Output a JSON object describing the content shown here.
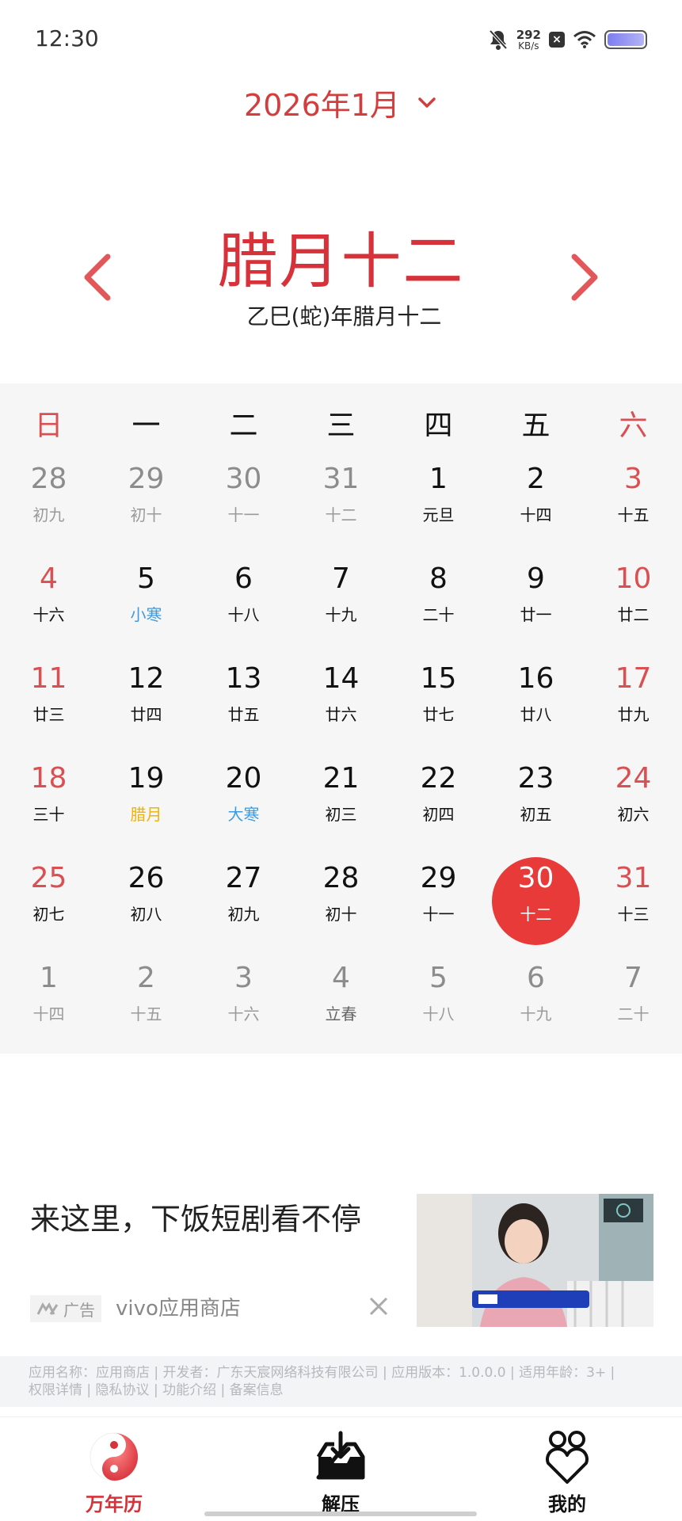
{
  "status_bar": {
    "time": "12:30",
    "net_speed_value": "292",
    "net_speed_unit": "KB/s",
    "icons": [
      "bell-muted-icon",
      "close-box-icon",
      "wifi-icon",
      "battery-icon"
    ]
  },
  "header": {
    "month_title": "2026年1月",
    "lunar_date": "腊月十二",
    "lunar_full": "乙巳(蛇)年腊月十二",
    "accent_color": "#d7323a"
  },
  "calendar": {
    "weekdays": [
      "日",
      "一",
      "二",
      "三",
      "四",
      "五",
      "六"
    ],
    "selected": "30",
    "weeks": [
      [
        {
          "d": "28",
          "l": "初九",
          "t": "other"
        },
        {
          "d": "29",
          "l": "初十",
          "t": "other"
        },
        {
          "d": "30",
          "l": "十一",
          "t": "other"
        },
        {
          "d": "31",
          "l": "十二",
          "t": "other"
        },
        {
          "d": "1",
          "l": "元旦",
          "t": "normal"
        },
        {
          "d": "2",
          "l": "十四",
          "t": "normal"
        },
        {
          "d": "3",
          "l": "十五",
          "t": "weekend"
        }
      ],
      [
        {
          "d": "4",
          "l": "十六",
          "t": "weekend"
        },
        {
          "d": "5",
          "l": "小寒",
          "t": "normal",
          "lc": "term"
        },
        {
          "d": "6",
          "l": "十八",
          "t": "normal"
        },
        {
          "d": "7",
          "l": "十九",
          "t": "normal"
        },
        {
          "d": "8",
          "l": "二十",
          "t": "normal"
        },
        {
          "d": "9",
          "l": "廿一",
          "t": "normal"
        },
        {
          "d": "10",
          "l": "廿二",
          "t": "weekend"
        }
      ],
      [
        {
          "d": "11",
          "l": "廿三",
          "t": "weekend"
        },
        {
          "d": "12",
          "l": "廿四",
          "t": "normal"
        },
        {
          "d": "13",
          "l": "廿五",
          "t": "normal"
        },
        {
          "d": "14",
          "l": "廿六",
          "t": "normal"
        },
        {
          "d": "15",
          "l": "廿七",
          "t": "normal"
        },
        {
          "d": "16",
          "l": "廿八",
          "t": "normal"
        },
        {
          "d": "17",
          "l": "廿九",
          "t": "weekend"
        }
      ],
      [
        {
          "d": "18",
          "l": "三十",
          "t": "weekend"
        },
        {
          "d": "19",
          "l": "腊月",
          "t": "normal",
          "lc": "month"
        },
        {
          "d": "20",
          "l": "大寒",
          "t": "normal",
          "lc": "term"
        },
        {
          "d": "21",
          "l": "初三",
          "t": "normal"
        },
        {
          "d": "22",
          "l": "初四",
          "t": "normal"
        },
        {
          "d": "23",
          "l": "初五",
          "t": "normal"
        },
        {
          "d": "24",
          "l": "初六",
          "t": "weekend"
        }
      ],
      [
        {
          "d": "25",
          "l": "初七",
          "t": "weekend"
        },
        {
          "d": "26",
          "l": "初八",
          "t": "normal"
        },
        {
          "d": "27",
          "l": "初九",
          "t": "normal"
        },
        {
          "d": "28",
          "l": "初十",
          "t": "normal"
        },
        {
          "d": "29",
          "l": "十一",
          "t": "normal"
        },
        {
          "d": "30",
          "l": "十二",
          "t": "today"
        },
        {
          "d": "31",
          "l": "十三",
          "t": "weekend"
        }
      ],
      [
        {
          "d": "1",
          "l": "十四",
          "t": "other"
        },
        {
          "d": "2",
          "l": "十五",
          "t": "other"
        },
        {
          "d": "3",
          "l": "十六",
          "t": "other"
        },
        {
          "d": "4",
          "l": "立春",
          "t": "other",
          "lc": "otherterm"
        },
        {
          "d": "5",
          "l": "十八",
          "t": "other"
        },
        {
          "d": "6",
          "l": "十九",
          "t": "other"
        },
        {
          "d": "7",
          "l": "二十",
          "t": "other"
        }
      ]
    ],
    "colors": {
      "normal": "#111111",
      "weekend": "#d94f52",
      "other_num": "#8c8c8c",
      "other_lunar": "#9a9a9a",
      "term": "#3d9be0",
      "month": "#f0b400",
      "today_bg": "#e93a3a",
      "today_text": "#ffffff"
    }
  },
  "ad": {
    "title": "来这里，下饭短剧看不停",
    "tag_label": "广告",
    "source": "vivo应用商店"
  },
  "footer": {
    "line1": "应用名称：应用商店 | 开发者：广东天宸网络科技有限公司 | 应用版本：1.0.0.0 | 适用年龄：3+ |",
    "links": [
      "权限详情",
      "隐私协议",
      "功能介绍",
      "备案信息"
    ]
  },
  "bottom_nav": {
    "items": [
      {
        "label": "万年历",
        "icon": "yin-yang-icon",
        "active": true
      },
      {
        "label": "解压",
        "icon": "inbox-download-icon",
        "active": false
      },
      {
        "label": "我的",
        "icon": "heart-people-icon",
        "active": false
      }
    ],
    "active_color": "#d7323a"
  }
}
